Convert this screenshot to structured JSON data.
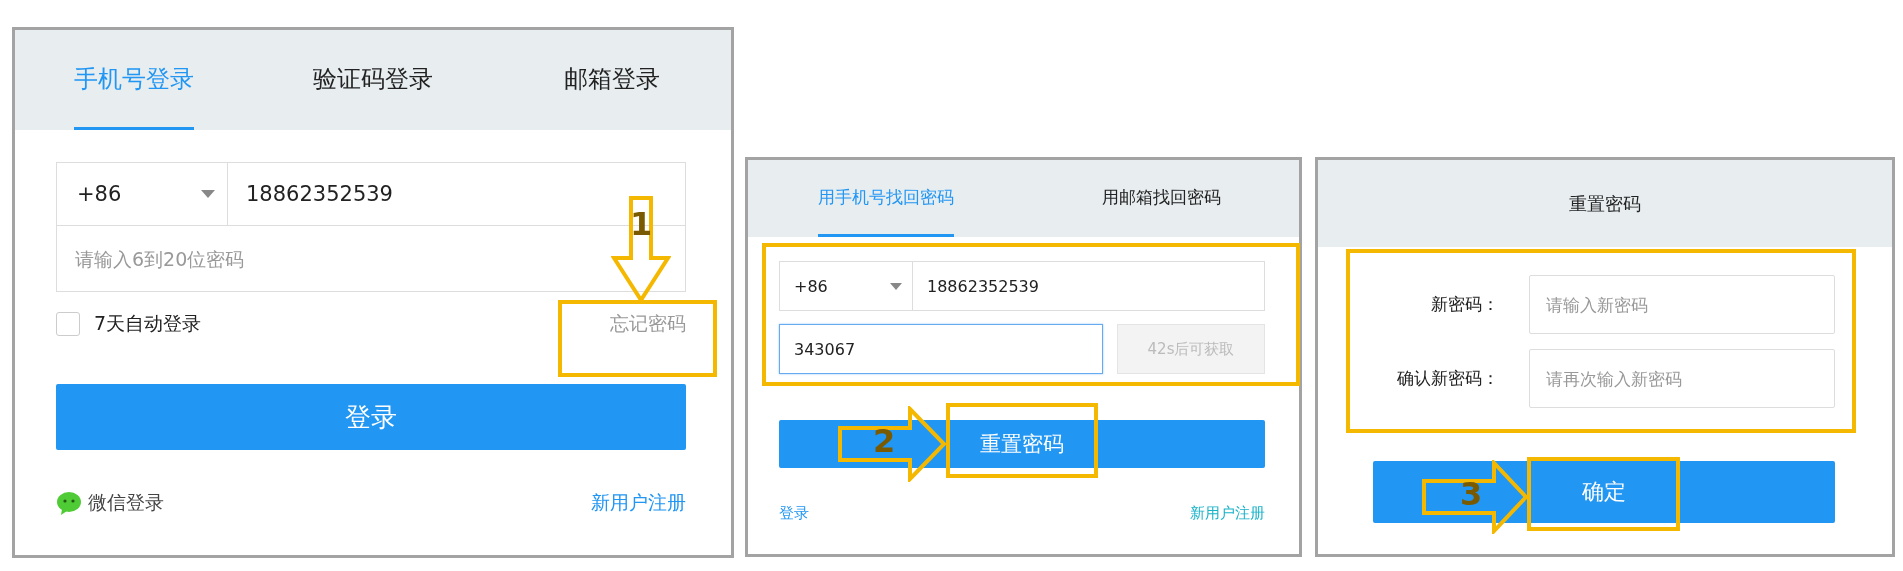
{
  "login_panel": {
    "tabs": [
      {
        "label": "手机号登录",
        "selected": true
      },
      {
        "label": "验证码登录",
        "selected": false
      },
      {
        "label": "邮箱登录",
        "selected": false
      }
    ],
    "country_code": "+86",
    "phone": "18862352539",
    "password": {
      "placeholder": "请输入6到20位密码"
    },
    "remember": {
      "label": "7天自动登录",
      "checked": false
    },
    "forgot_link": "忘记密码",
    "login_button": "登录",
    "wechat_login": "微信登录",
    "register_link": "新用户注册",
    "annotation": {
      "number": "1"
    }
  },
  "recover_panel": {
    "tabs": [
      {
        "label": "用手机号找回密码",
        "selected": true
      },
      {
        "label": "用邮箱找回密码",
        "selected": false
      }
    ],
    "country_code": "+86",
    "phone": "18862352539",
    "code": {
      "value": "343067",
      "focused": true
    },
    "get_code_button": {
      "label": "42s后可获取",
      "disabled": true
    },
    "reset_button": "重置密码",
    "login_link": "登录",
    "register_link": "新用户注册",
    "annotation": {
      "number": "2"
    }
  },
  "reset_panel": {
    "title": "重置密码",
    "fields": [
      {
        "label": "新密码：",
        "placeholder": "请输入新密码"
      },
      {
        "label": "确认新密码：",
        "placeholder": "请再次输入新密码"
      }
    ],
    "confirm_button": "确定",
    "annotation": {
      "number": "3"
    }
  }
}
